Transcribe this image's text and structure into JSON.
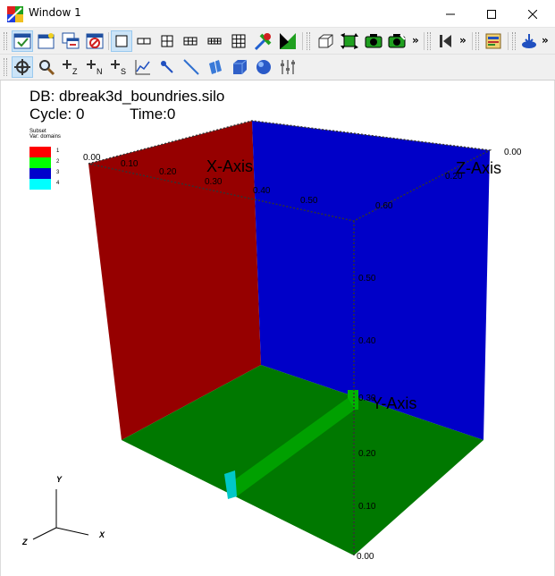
{
  "window": {
    "title": "Window 1",
    "controls": [
      "minimize",
      "maximize",
      "close"
    ]
  },
  "toolbar1": {
    "buttons": [
      {
        "name": "active-window-icon",
        "pressed": true
      },
      {
        "name": "new-window-icon"
      },
      {
        "name": "clone-window-icon"
      },
      {
        "name": "delete-window-icon"
      },
      {
        "name": "layout-1x1-icon",
        "pressed": true
      },
      {
        "name": "layout-1x2-icon"
      },
      {
        "name": "layout-2x2-icon"
      },
      {
        "name": "layout-2x3-icon"
      },
      {
        "name": "layout-2x4-icon"
      },
      {
        "name": "layout-3x3-icon"
      },
      {
        "name": "lock-view-icon"
      },
      {
        "name": "lock-time-icon"
      },
      {
        "name": "bounding-box-icon"
      },
      {
        "name": "spin-mode-icon"
      },
      {
        "name": "camera-icon"
      },
      {
        "name": "save-image-icon"
      },
      {
        "name": "previous-frame-icon"
      },
      {
        "name": "expression-editor-icon"
      },
      {
        "name": "save-session-icon"
      }
    ],
    "more_label": "»"
  },
  "toolbar2": {
    "buttons": [
      {
        "name": "navigate-mode-icon",
        "pressed": true
      },
      {
        "name": "zoom-mode-icon"
      },
      {
        "name": "zone-pick-icon",
        "label": "Z"
      },
      {
        "name": "node-pick-icon",
        "label": "N"
      },
      {
        "name": "spreadsheet-pick-icon",
        "label": "S"
      },
      {
        "name": "curve-lineout-icon"
      },
      {
        "name": "point-tool-icon"
      },
      {
        "name": "line-tool-icon"
      },
      {
        "name": "plane-tool-icon"
      },
      {
        "name": "box-tool-icon"
      },
      {
        "name": "sphere-tool-icon"
      },
      {
        "name": "axis-restriction-icon"
      }
    ]
  },
  "annotation": {
    "db": "DB: dbreak3d_boundries.silo",
    "cycle": "Cycle: 0",
    "time": "Time:0"
  },
  "legend": {
    "title": "Subset",
    "var": "Var: domains",
    "items": [
      {
        "label": "1",
        "color": "#ff0000"
      },
      {
        "label": "2",
        "color": "#00ff00"
      },
      {
        "label": "3",
        "color": "#0000cc"
      },
      {
        "label": "4",
        "color": "#00ffff"
      }
    ]
  },
  "scene": {
    "colors": {
      "left_wall": "#960000",
      "back_wall": "#0000c8",
      "floor": "#007800",
      "floor_bar": "#00a000",
      "cyan_marker": "#00c8c8"
    },
    "x_axis": {
      "title": "X-Axis",
      "ticks": [
        "0.00",
        "0.10",
        "0.20",
        "0.30",
        "0.40",
        "0.50",
        "0.60"
      ]
    },
    "z_axis": {
      "title": "Z-Axis",
      "ticks": [
        "0.00",
        "0.20"
      ]
    },
    "y_axis": {
      "title": "Y-Axis",
      "ticks": [
        "0.00",
        "0.10",
        "0.20",
        "0.30",
        "0.40",
        "0.50"
      ]
    },
    "triad": {
      "y": "Y",
      "z": "Z",
      "x": "X"
    }
  }
}
